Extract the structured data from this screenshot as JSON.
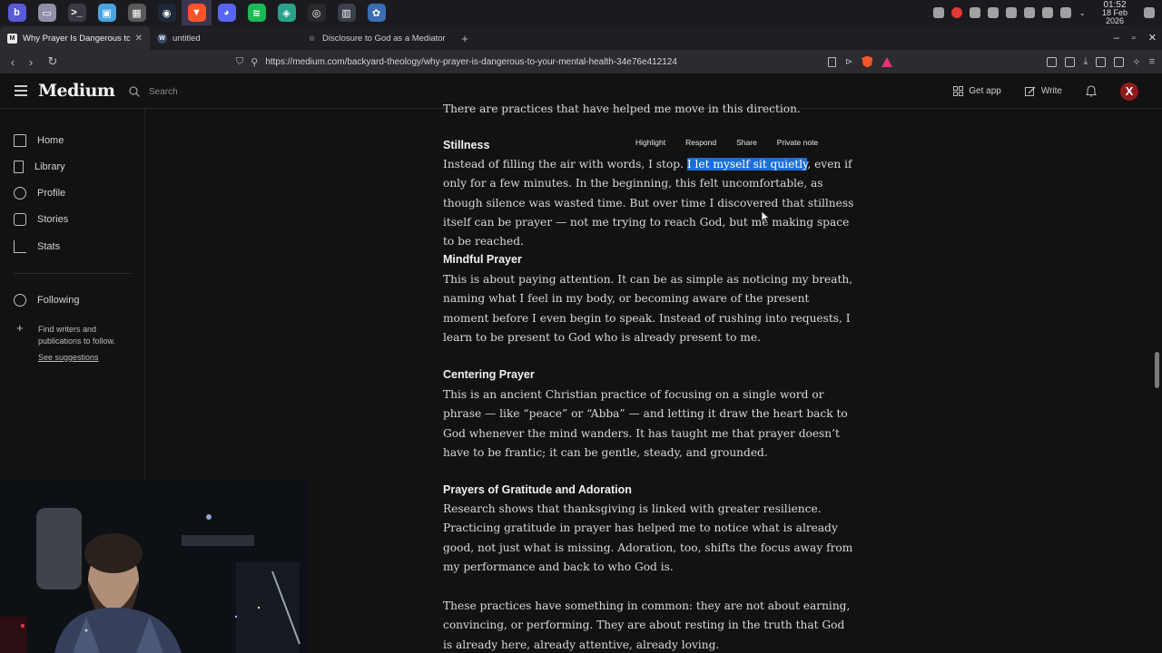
{
  "taskbar": {
    "apps": [
      {
        "name": "app-menu-icon",
        "color": "#5b5bd6",
        "glyph": "b"
      },
      {
        "name": "file-manager-icon",
        "color": "#8f8fa8",
        "glyph": "▭"
      },
      {
        "name": "terminal-icon",
        "color": "#3a3a44",
        "glyph": ">_"
      },
      {
        "name": "image-viewer-icon",
        "color": "#4aa3df",
        "glyph": "▣"
      },
      {
        "name": "calculator-icon",
        "color": "#5a5a5a",
        "glyph": "▦"
      },
      {
        "name": "steam-icon",
        "color": "#1b2838",
        "glyph": "◉"
      },
      {
        "name": "brave-icon",
        "color": "#fb542b",
        "glyph": "▼"
      },
      {
        "name": "discord-icon",
        "color": "#5865f2",
        "glyph": "◕"
      },
      {
        "name": "spotify-icon",
        "color": "#1db954",
        "glyph": "≋"
      },
      {
        "name": "layers-icon",
        "color": "#2aa18a",
        "glyph": "◈"
      },
      {
        "name": "obs-icon",
        "color": "#2a2a2a",
        "glyph": "◎"
      },
      {
        "name": "video-editor-icon",
        "color": "#3a3f4a",
        "glyph": "▥"
      },
      {
        "name": "krita-icon",
        "color": "#3b6db3",
        "glyph": "✿"
      }
    ],
    "clock_time": "01:52",
    "clock_date": "18 Feb 2026"
  },
  "tabs": [
    {
      "title": "Why Prayer Is Dangerous to",
      "favicon": "M",
      "active": true
    },
    {
      "title": "untitled",
      "favicon": "W",
      "active": false
    },
    {
      "title": "Disclosure to God as a Mediator",
      "favicon": "◎",
      "active": false
    }
  ],
  "address": {
    "url": "https://medium.com/backyard-theology/why-prayer-is-dangerous-to-your-mental-health-34e76e412124"
  },
  "medium": {
    "logo": "Medium",
    "search_placeholder": "Search",
    "get_app": "Get app",
    "write": "Write",
    "avatar_letter": "X"
  },
  "sidebar": {
    "items": [
      "Home",
      "Library",
      "Profile",
      "Stories",
      "Stats"
    ],
    "following": "Following",
    "find_writers": "Find writers and publications to follow.",
    "see_suggestions": "See suggestions"
  },
  "selection_toolbar": [
    "Highlight",
    "Respond",
    "Share",
    "Private note"
  ],
  "article": {
    "intro": "There are practices that have helped me move in this direction.",
    "stillness_heading": "Stillness",
    "stillness_pre": "Instead of filling the air with words, I stop. ",
    "stillness_highlight": "I let myself sit quietly",
    "stillness_post": ", even if only for a few minutes. In the beginning, this felt uncomfortable, as though silence was wasted time. But over time I discovered that stillness itself can be prayer — not me trying to reach God, but me making space to be reached.",
    "mindful_heading": "Mindful Prayer",
    "mindful_text": "This is about paying attention. It can be as simple as noticing my breath, naming what I feel in my body, or becoming aware of the present moment before I even begin to speak. Instead of rushing into requests, I learn to be present to God who is already present to me.",
    "centering_heading": "Centering Prayer",
    "centering_text": "This is an ancient Christian practice of focusing on a single word or phrase — like “peace” or “Abba” — and letting it draw the heart back to God whenever the mind wanders. It has taught me that prayer doesn’t have to be frantic; it can be gentle, steady, and grounded.",
    "gratitude_heading": "Prayers of Gratitude and Adoration",
    "gratitude_text": "Research shows that thanksgiving is linked with greater resilience. Practicing gratitude in prayer has helped me to notice what is already good, not just what is missing. Adoration, too, shifts the focus away from my performance and back to who God is.",
    "closing_text": "These practices have something in common: they are not about earning, convincing, or performing. They are about resting in the truth that God is already here, already attentive, already loving."
  }
}
